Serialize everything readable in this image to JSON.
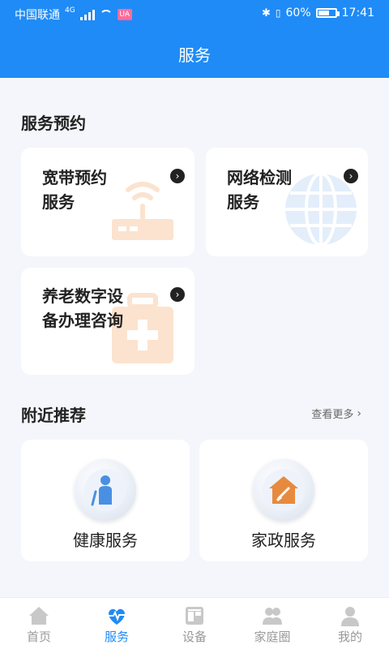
{
  "status_bar": {
    "carrier": "中国联通",
    "network": "4G",
    "app_badge": "UA",
    "battery": "60%",
    "time": "17:41"
  },
  "header": {
    "title": "服务"
  },
  "service_booking": {
    "title": "服务预约",
    "items": [
      {
        "label_line1": "宽带预约",
        "label_line2": "服务",
        "icon": "router-icon",
        "accent": "#f7a64a"
      },
      {
        "label_line1": "网络检测",
        "label_line2": "服务",
        "icon": "globe-icon",
        "accent": "#4a90e2"
      },
      {
        "label_line1": "养老数字设",
        "label_line2": "备办理咨询",
        "icon": "medical-kit-icon",
        "accent": "#f7a64a"
      }
    ]
  },
  "nearby": {
    "title": "附近推荐",
    "more_label": "查看更多",
    "items": [
      {
        "label": "健康服务",
        "icon": "elderly-person-icon"
      },
      {
        "label": "家政服务",
        "icon": "home-cleaning-icon"
      }
    ]
  },
  "tabbar": {
    "items": [
      {
        "label": "首页",
        "icon": "home-icon",
        "active": false
      },
      {
        "label": "服务",
        "icon": "heartbeat-icon",
        "active": true
      },
      {
        "label": "设备",
        "icon": "device-icon",
        "active": false
      },
      {
        "label": "家庭圈",
        "icon": "family-icon",
        "active": false
      },
      {
        "label": "我的",
        "icon": "profile-icon",
        "active": false
      }
    ]
  },
  "colors": {
    "primary": "#1f8bf6",
    "inactive": "#999999"
  }
}
